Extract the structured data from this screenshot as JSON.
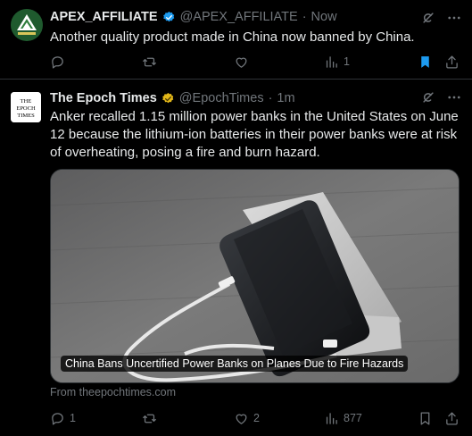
{
  "tweets": [
    {
      "name": "APEX_AFFILIATE",
      "handle": "@APEX_AFFILIATE",
      "separator": "·",
      "time": "Now",
      "verified": "blue-check",
      "text": "Another quality product made in China now banned by China.",
      "actions": {
        "replies": "",
        "reposts": "",
        "likes": "",
        "views": "1"
      },
      "bookmarked": true,
      "avatar_logo_text": "APEX AFFILIATE"
    },
    {
      "name": "The Epoch Times",
      "handle": "@EpochTimes",
      "separator": "·",
      "time": "1m",
      "verified": "gold-check",
      "avatar_logo_text": "THE EPOCH TIMES",
      "text": "Anker recalled 1.15 million power banks in the United States on June 12 because the lithium-ion batteries in their power banks were at risk of overheating, posing a fire and burn hazard.",
      "card": {
        "caption": "China Bans Uncertified Power Banks on Planes Due to Fire Hazards",
        "source": "From theepochtimes.com"
      },
      "actions": {
        "replies": "1",
        "reposts": "",
        "likes": "2",
        "views": "877"
      },
      "bookmarked": false
    }
  ],
  "colors": {
    "background": "#000000",
    "text": "#e7e9ea",
    "muted": "#71767b",
    "accent": "#1d9bf0",
    "gold": "#e2b719"
  }
}
